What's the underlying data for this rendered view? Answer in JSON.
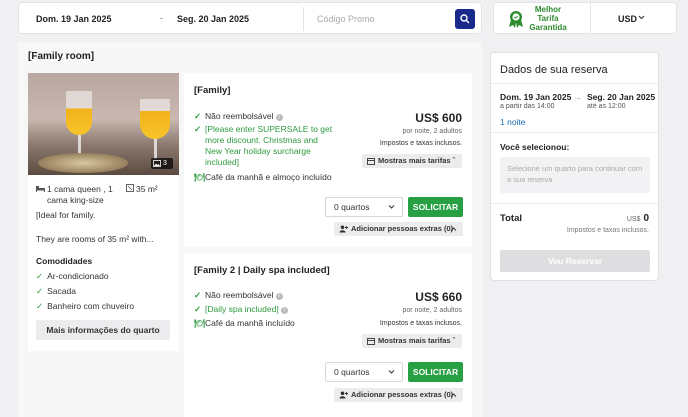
{
  "search": {
    "checkin": "Dom. 19 Jan 2025",
    "dash": "-",
    "checkout": "Seg. 20 Jan 2025",
    "promo_placeholder": "Código Promo"
  },
  "best_rate": {
    "line1": "Melhor",
    "line2": "Tarifa",
    "line3": "Garantida"
  },
  "currency": "USD",
  "room": {
    "title": "[Family room]",
    "photo_count": "3",
    "bed_line1": "1 cama queen , 1",
    "bed_line2": "cama king-size",
    "size": "35 m²",
    "desc1": "[Ideal for family.",
    "desc2": "They are rooms of 35 m² with...",
    "amenities_title": "Comodidades",
    "amenities": [
      "Ar-condicionado",
      "Sacada",
      "Banheiro com chuveiro"
    ],
    "more_info": "Mais informações do quarto"
  },
  "rates": [
    {
      "title": "[Family]",
      "nonrefundable": "Não reembolsável",
      "promo_lines": [
        "[Please enter SUPERSALE to get",
        "more discount. Christmas and",
        "New Year holiday surcharge",
        "included]"
      ],
      "meal": "Café da manhã e almoço incluído",
      "price": "US$ 600",
      "per_night": "por noite, 2 adultos",
      "taxes": "Impostos e taxas inclusos.",
      "more_rates": "Mostras mais tarifas",
      "qty": "0 quartos",
      "request": "SOLICITAR",
      "extras": "Adicionar pessoas extras (0)"
    },
    {
      "title": "[Family 2 | Daily spa included]",
      "nonrefundable": "Não reembolsável",
      "promo_lines": [
        "[Daily spa included]"
      ],
      "meal": "Café da manhã incluído",
      "price": "US$ 660",
      "per_night": "por noite, 2 adultos",
      "taxes": "Impostos e taxas inclusos.",
      "more_rates": "Mostras mais tarifas",
      "qty": "0 quartos",
      "request": "SOLICITAR",
      "extras": "Adicionar pessoas extras (0)"
    }
  ],
  "reservation": {
    "title": "Dados de sua reserva",
    "checkin": "Dom. 19 Jan 2025",
    "checkin_sub": "a partir das 14:00",
    "checkout": "Seg. 20 Jan 2025",
    "checkout_sub": "até as 12:00",
    "nights": "1 noite",
    "selected_label": "Você selecionou:",
    "selected_placeholder": "Selecione um quarto para continuar com a sua reserva",
    "total_label": "Total",
    "total_currency": "US$",
    "total_value": "0",
    "taxes": "Impostos e taxas inclusos.",
    "book_button": "Vou Reservar"
  },
  "colors": {
    "accent_blue": "#1a2a8c",
    "green": "#27a043",
    "link": "#1a6fb5"
  }
}
